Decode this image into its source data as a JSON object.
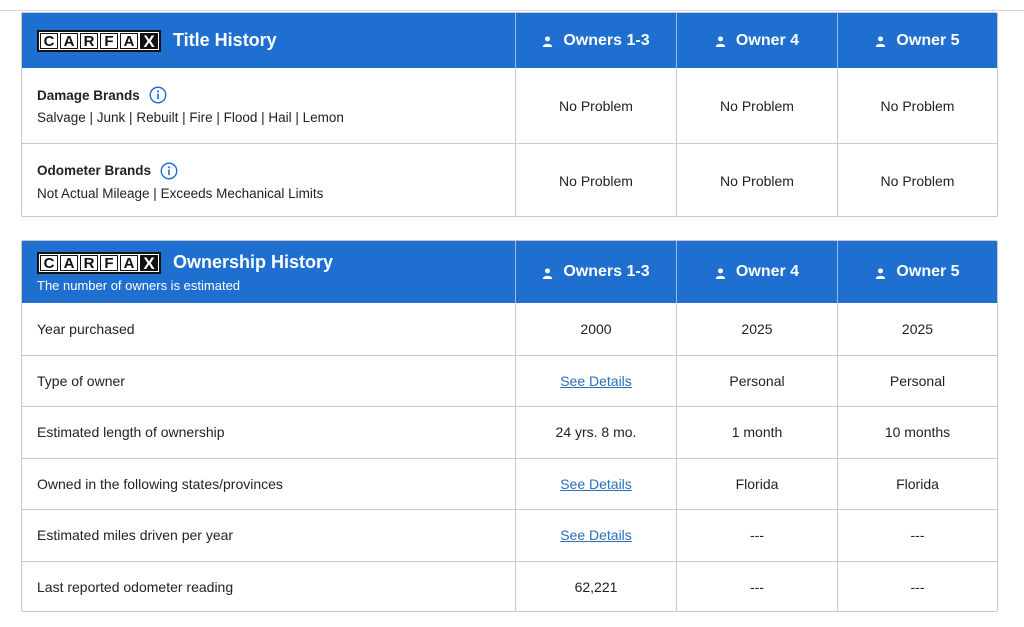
{
  "logo_letters": [
    "C",
    "A",
    "R",
    "F",
    "A",
    "X"
  ],
  "title_history": {
    "title": "Title History",
    "columns": [
      "Owners 1-3",
      "Owner 4",
      "Owner 5"
    ],
    "rows": [
      {
        "label": "Damage Brands",
        "desc": "Salvage | Junk | Rebuilt | Fire | Flood | Hail | Lemon",
        "values": [
          "No Problem",
          "No Problem",
          "No Problem"
        ]
      },
      {
        "label": "Odometer Brands",
        "desc": "Not Actual Mileage | Exceeds Mechanical Limits",
        "values": [
          "No Problem",
          "No Problem",
          "No Problem"
        ]
      }
    ]
  },
  "ownership_history": {
    "title": "Ownership History",
    "subtitle": "The number of owners is estimated",
    "columns": [
      "Owners 1-3",
      "Owner 4",
      "Owner 5"
    ],
    "rows": [
      {
        "label": "Year purchased",
        "values": [
          "2000",
          "2025",
          "2025"
        ]
      },
      {
        "label": "Type of owner",
        "values": [
          "See Details",
          "Personal",
          "Personal"
        ]
      },
      {
        "label": "Estimated length of ownership",
        "values": [
          "24 yrs. 8 mo.",
          "1 month",
          "10 months"
        ]
      },
      {
        "label": "Owned in the following states/provinces",
        "values": [
          "See Details",
          "Florida",
          "Florida"
        ]
      },
      {
        "label": "Estimated miles driven per year",
        "values": [
          "See Details",
          "---",
          "---"
        ]
      },
      {
        "label": "Last reported odometer reading",
        "values": [
          "62,221",
          "---",
          "---"
        ]
      }
    ]
  },
  "colors": {
    "header_blue": "#1f6fd1",
    "link": "#2a6fb8",
    "border": "#c9c9c9"
  }
}
